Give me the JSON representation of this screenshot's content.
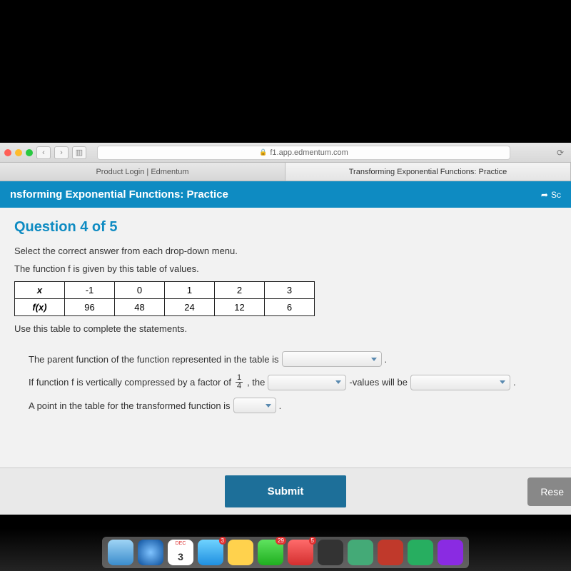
{
  "browser": {
    "url_host": "f1.app.edmentum.com",
    "tabs": [
      "Product Login | Edmentum",
      "Transforming Exponential Functions: Practice"
    ],
    "active_tab_index": 1
  },
  "app_header": {
    "title_left": "nsforming Exponential Functions: Practice",
    "title_right": "Sc"
  },
  "question": {
    "number_label": "Question 4 of 5",
    "instruction": "Select the correct answer from each drop-down menu.",
    "prompt": "The function f is given by this table of values.",
    "table": {
      "row_labels": [
        "x",
        "f(x)"
      ],
      "x": [
        "-1",
        "0",
        "1",
        "2",
        "3"
      ],
      "fx": [
        "96",
        "48",
        "24",
        "12",
        "6"
      ]
    },
    "after_table": "Use this table to complete the statements.",
    "s1_a": "The parent function of the function represented in the table is",
    "s1_b": ".",
    "s2_a": "If function f is vertically compressed by a factor of",
    "s2_frac_n": "1",
    "s2_frac_d": "4",
    "s2_b": ", the",
    "s2_c": "-values will be",
    "s2_d": ".",
    "s3_a": "A point in the table for the transformed function is",
    "s3_b": "."
  },
  "actions": {
    "submit": "Submit",
    "reset": "Rese"
  },
  "dock": {
    "calendar_day": "3",
    "badges": {
      "mail": "3",
      "msg": "29",
      "app": "5"
    }
  }
}
